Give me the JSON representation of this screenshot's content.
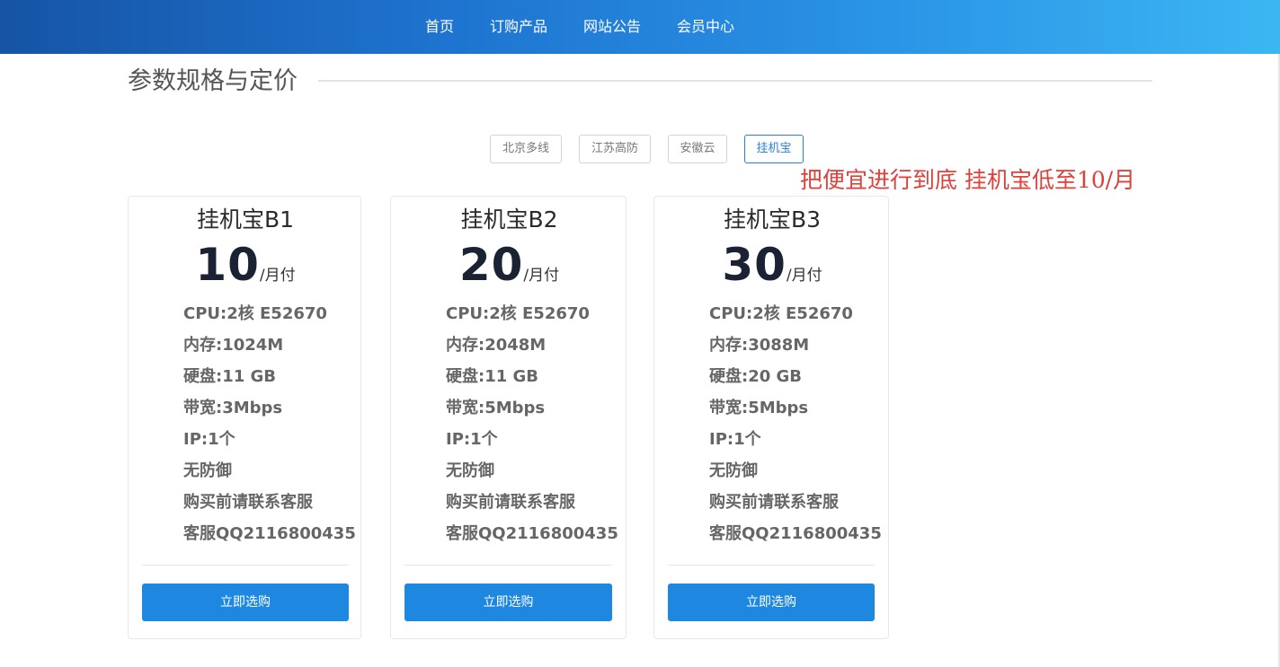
{
  "nav": {
    "items": [
      {
        "label": "首页"
      },
      {
        "label": "订购产品"
      },
      {
        "label": "网站公告"
      },
      {
        "label": "会员中心"
      }
    ]
  },
  "section": {
    "title": "参数规格与定价"
  },
  "tabs": [
    {
      "label": "北京多线",
      "active": false
    },
    {
      "label": "江苏高防",
      "active": false
    },
    {
      "label": "安徽云",
      "active": false
    },
    {
      "label": "挂机宝",
      "active": true
    }
  ],
  "promo": "把便宜进行到底 挂机宝低至10/月",
  "plans": [
    {
      "name": "挂机宝B1",
      "price": "10",
      "unit": "/月付",
      "specs": [
        "CPU:2核 E52670",
        "内存:1024M",
        "硬盘:11 GB",
        "带宽:3Mbps",
        "IP:1个",
        "无防御",
        "购买前请联系客服",
        "客服QQ2116800435"
      ],
      "buy_label": "立即选购"
    },
    {
      "name": "挂机宝B2",
      "price": "20",
      "unit": "/月付",
      "specs": [
        "CPU:2核 E52670",
        "内存:2048M",
        "硬盘:11 GB",
        "带宽:5Mbps",
        "IP:1个",
        "无防御",
        "购买前请联系客服",
        "客服QQ2116800435"
      ],
      "buy_label": "立即选购"
    },
    {
      "name": "挂机宝B3",
      "price": "30",
      "unit": "/月付",
      "specs": [
        "CPU:2核 E52670",
        "内存:3088M",
        "硬盘:20 GB",
        "带宽:5Mbps",
        "IP:1个",
        "无防御",
        "购买前请联系客服",
        "客服QQ2116800435"
      ],
      "buy_label": "立即选购"
    }
  ],
  "colors": {
    "header_gradient_start": "#1654a5",
    "header_gradient_end": "#3cb6f3",
    "accent": "#1e88e0",
    "promo": "#e13f3a",
    "active_tab": "#2c7fd4"
  }
}
